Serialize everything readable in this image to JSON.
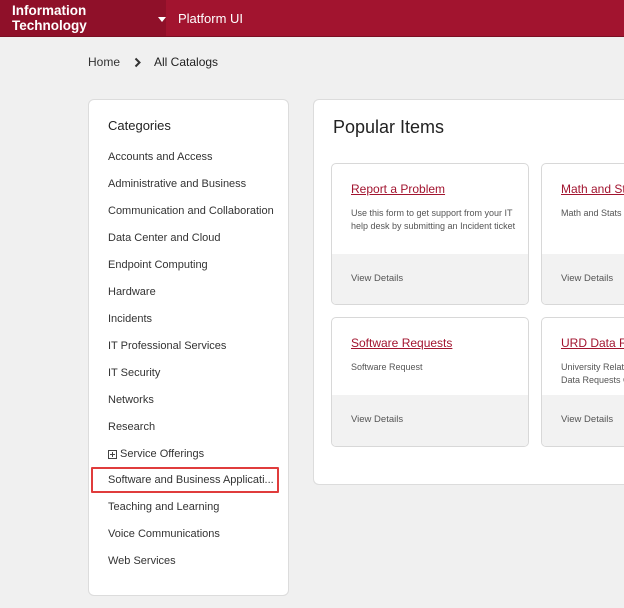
{
  "header": {
    "brand_label": "Information Technology",
    "nav_link": "Platform UI"
  },
  "breadcrumb": {
    "home": "Home",
    "current": "All Catalogs"
  },
  "categories": {
    "title": "Categories",
    "items": [
      "Accounts and Access",
      "Administrative and Business",
      "Communication and Collaboration",
      "Data Center and Cloud",
      "Endpoint Computing",
      "Hardware",
      "Incidents",
      "IT Professional Services",
      "IT Security",
      "Networks",
      "Research",
      "Service Offerings",
      "Software and Business Applicati...",
      "Teaching and Learning",
      "Voice Communications",
      "Web Services"
    ]
  },
  "popular": {
    "title": "Popular Items",
    "cards": [
      {
        "title": "Report a Problem",
        "desc": "Use this form to get support from your IT help desk by submitting an Incident ticket",
        "link": "View Details"
      },
      {
        "title": "Math and St",
        "desc": "Math and Stats",
        "link": "View Details"
      },
      {
        "title": "Software Requests",
        "desc": "Software Request",
        "link": "View Details"
      },
      {
        "title": "URD Data R",
        "desc": "University Relat Data Requests C",
        "link": "View Details"
      }
    ]
  },
  "colors": {
    "brand": "#a2142f",
    "highlight": "#e03c3c"
  }
}
